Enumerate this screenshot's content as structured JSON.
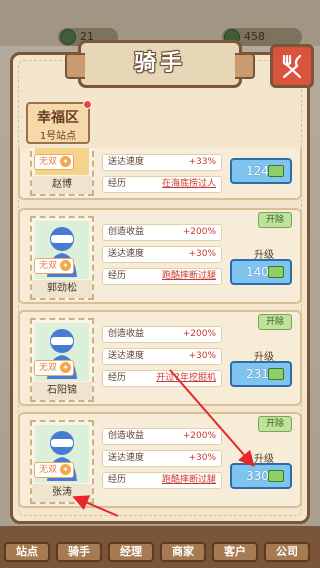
{
  "topbar": {
    "coins": "21",
    "cash": "458"
  },
  "title": "骑手",
  "district": {
    "name": "幸福区",
    "station": "1号站点"
  },
  "riders": [
    {
      "name": "赵博",
      "badge": "无双",
      "stats": [
        {
          "label": "送达速度",
          "value": "+33%"
        },
        {
          "label": "经历",
          "value": "在海底捞过人"
        }
      ],
      "upgrade_cost": "124"
    },
    {
      "name": "郭劲松",
      "badge": "无双",
      "fire_label": "开除",
      "stats": [
        {
          "label": "创造收益",
          "value": "+200%"
        },
        {
          "label": "送达速度",
          "value": "+30%"
        },
        {
          "label": "经历",
          "value": "跑酷摔断过腿"
        }
      ],
      "upgrade_label": "升级",
      "upgrade_cost": "140"
    },
    {
      "name": "石阳锦",
      "badge": "无双",
      "fire_label": "开除",
      "stats": [
        {
          "label": "创造收益",
          "value": "+200%"
        },
        {
          "label": "送达速度",
          "value": "+30%"
        },
        {
          "label": "经历",
          "value": "开过7年挖掘机"
        }
      ],
      "upgrade_label": "升级",
      "upgrade_cost": "231"
    },
    {
      "name": "张涛",
      "badge": "无双",
      "fire_label": "开除",
      "stats": [
        {
          "label": "创造收益",
          "value": "+200%"
        },
        {
          "label": "送达速度",
          "value": "+30%"
        },
        {
          "label": "经历",
          "value": "跑酷摔断过腿"
        }
      ],
      "upgrade_label": "升级",
      "upgrade_cost": "330"
    }
  ],
  "nav": [
    "站点",
    "骑手",
    "经理",
    "商家",
    "客户",
    "公司"
  ],
  "colors": {
    "accent_red": "#e8463a",
    "panel_border": "#7a5538",
    "upgrade_blue": "#7fc3ef",
    "fire_green": "#bfe39b"
  }
}
